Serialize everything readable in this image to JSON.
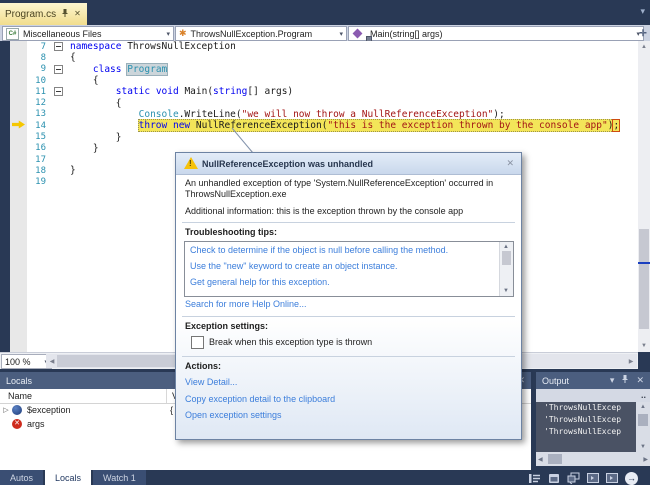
{
  "tab_bar": {
    "active_tab": "Program.cs"
  },
  "nav_bar": {
    "scope": "Miscellaneous Files",
    "type": "ThrowsNullException.Program",
    "member": "Main(string[] args)"
  },
  "editor": {
    "zoom_level": "100 %",
    "current_line": 14,
    "lines": [
      {
        "n": 7,
        "fold": true,
        "segs": [
          {
            "c": "kw",
            "t": "namespace"
          },
          {
            "c": "pl",
            "t": " ThrowsNullException"
          }
        ]
      },
      {
        "n": 8,
        "segs": [
          {
            "c": "pl",
            "t": "{"
          }
        ]
      },
      {
        "n": 9,
        "fold": true,
        "segs": [
          {
            "c": "pl",
            "t": "    "
          },
          {
            "c": "kw",
            "t": "class"
          },
          {
            "c": "pl",
            "t": " "
          },
          {
            "c": "type box",
            "t": "Program"
          }
        ]
      },
      {
        "n": 10,
        "segs": [
          {
            "c": "pl",
            "t": "    {"
          }
        ]
      },
      {
        "n": 11,
        "fold": true,
        "segs": [
          {
            "c": "pl",
            "t": "        "
          },
          {
            "c": "kw",
            "t": "static"
          },
          {
            "c": "pl",
            "t": " "
          },
          {
            "c": "kw",
            "t": "void"
          },
          {
            "c": "pl",
            "t": " Main("
          },
          {
            "c": "kw",
            "t": "string"
          },
          {
            "c": "pl",
            "t": "[] args)"
          }
        ]
      },
      {
        "n": 12,
        "segs": [
          {
            "c": "pl",
            "t": "        {"
          }
        ]
      },
      {
        "n": 13,
        "segs": [
          {
            "c": "pl",
            "t": "            "
          },
          {
            "c": "type",
            "t": "Console"
          },
          {
            "c": "pl",
            "t": ".WriteLine("
          },
          {
            "c": "str",
            "t": "\"we will now throw a NullReferenceException\""
          },
          {
            "c": "pl",
            "t": ");"
          }
        ]
      },
      {
        "n": 14,
        "current": true,
        "indent": "            ",
        "segs": [
          {
            "c": "kw",
            "t": "throw"
          },
          {
            "c": "pl",
            "t": " "
          },
          {
            "c": "kw",
            "t": "new"
          },
          {
            "c": "pl",
            "t": " NullReferenceException("
          },
          {
            "c": "str",
            "t": "\"this is the exception thrown by the console app\""
          },
          {
            "c": "pl",
            "t": ")"
          },
          {
            "c": "semi",
            "t": ";"
          }
        ]
      },
      {
        "n": 15,
        "segs": [
          {
            "c": "pl",
            "t": "        }"
          }
        ]
      },
      {
        "n": 16,
        "segs": [
          {
            "c": "pl",
            "t": "    }"
          }
        ]
      },
      {
        "n": 17,
        "segs": []
      },
      {
        "n": 18,
        "segs": [
          {
            "c": "pl",
            "t": "}"
          }
        ]
      },
      {
        "n": 19,
        "segs": []
      }
    ]
  },
  "dialog": {
    "title": "NullReferenceException was unhandled",
    "message": "An unhandled exception of type 'System.NullReferenceException' occurred in ThrowsNullException.exe",
    "additional": "Additional information: this is the exception thrown by the console app",
    "tips_label": "Troubleshooting tips:",
    "tips": [
      "Check to determine if the object is null before calling the method.",
      "Use the \"new\" keyword to create an object instance.",
      "Get general help for this exception."
    ],
    "search_link": "Search for more Help Online...",
    "settings_label": "Exception settings:",
    "checkbox_label": "Break when this exception type is thrown",
    "checkbox_checked": false,
    "actions_label": "Actions:",
    "actions": [
      "View Detail...",
      "Copy exception detail to the clipboard",
      "Open exception settings"
    ]
  },
  "locals_panel": {
    "title": "Locals",
    "columns": [
      "Name",
      "Value"
    ],
    "rows": [
      {
        "icon": "exception-object-icon",
        "expander": true,
        "name": "$exception",
        "value": "{"
      },
      {
        "icon": "error-icon",
        "expander": false,
        "name": "args",
        "value": ""
      }
    ]
  },
  "watch_tabs": {
    "items": [
      "Autos",
      "Locals",
      "Watch 1"
    ],
    "active": "Locals"
  },
  "output_panel": {
    "title": "Output",
    "toolbar_overflow": "..",
    "lines": [
      "'ThrowsNullExcep",
      "'ThrowsNullExcep",
      "'ThrowsNullExcep"
    ]
  },
  "icons": {
    "close": "✕",
    "dropdown": "▾",
    "scroll_up": "▲",
    "scroll_down": "▼",
    "scroll_left": "◀",
    "scroll_right": "▶",
    "expander": "▷",
    "class_glyph": "✱",
    "grip": "✛",
    "goto_arrow": "→",
    "csharp": "C#"
  },
  "colors": {
    "frame": "#293955",
    "panel_title": "#4b5e7f",
    "tab_active": "#f4e49c",
    "keyword": "#0000f0",
    "type": "#2b91af",
    "string": "#a31515",
    "line_highlight": "#f3e559",
    "link": "#3c7edb",
    "line_number": "#2b91af",
    "output_bg": "#4a5264",
    "current_arrow": "#f5c700"
  }
}
